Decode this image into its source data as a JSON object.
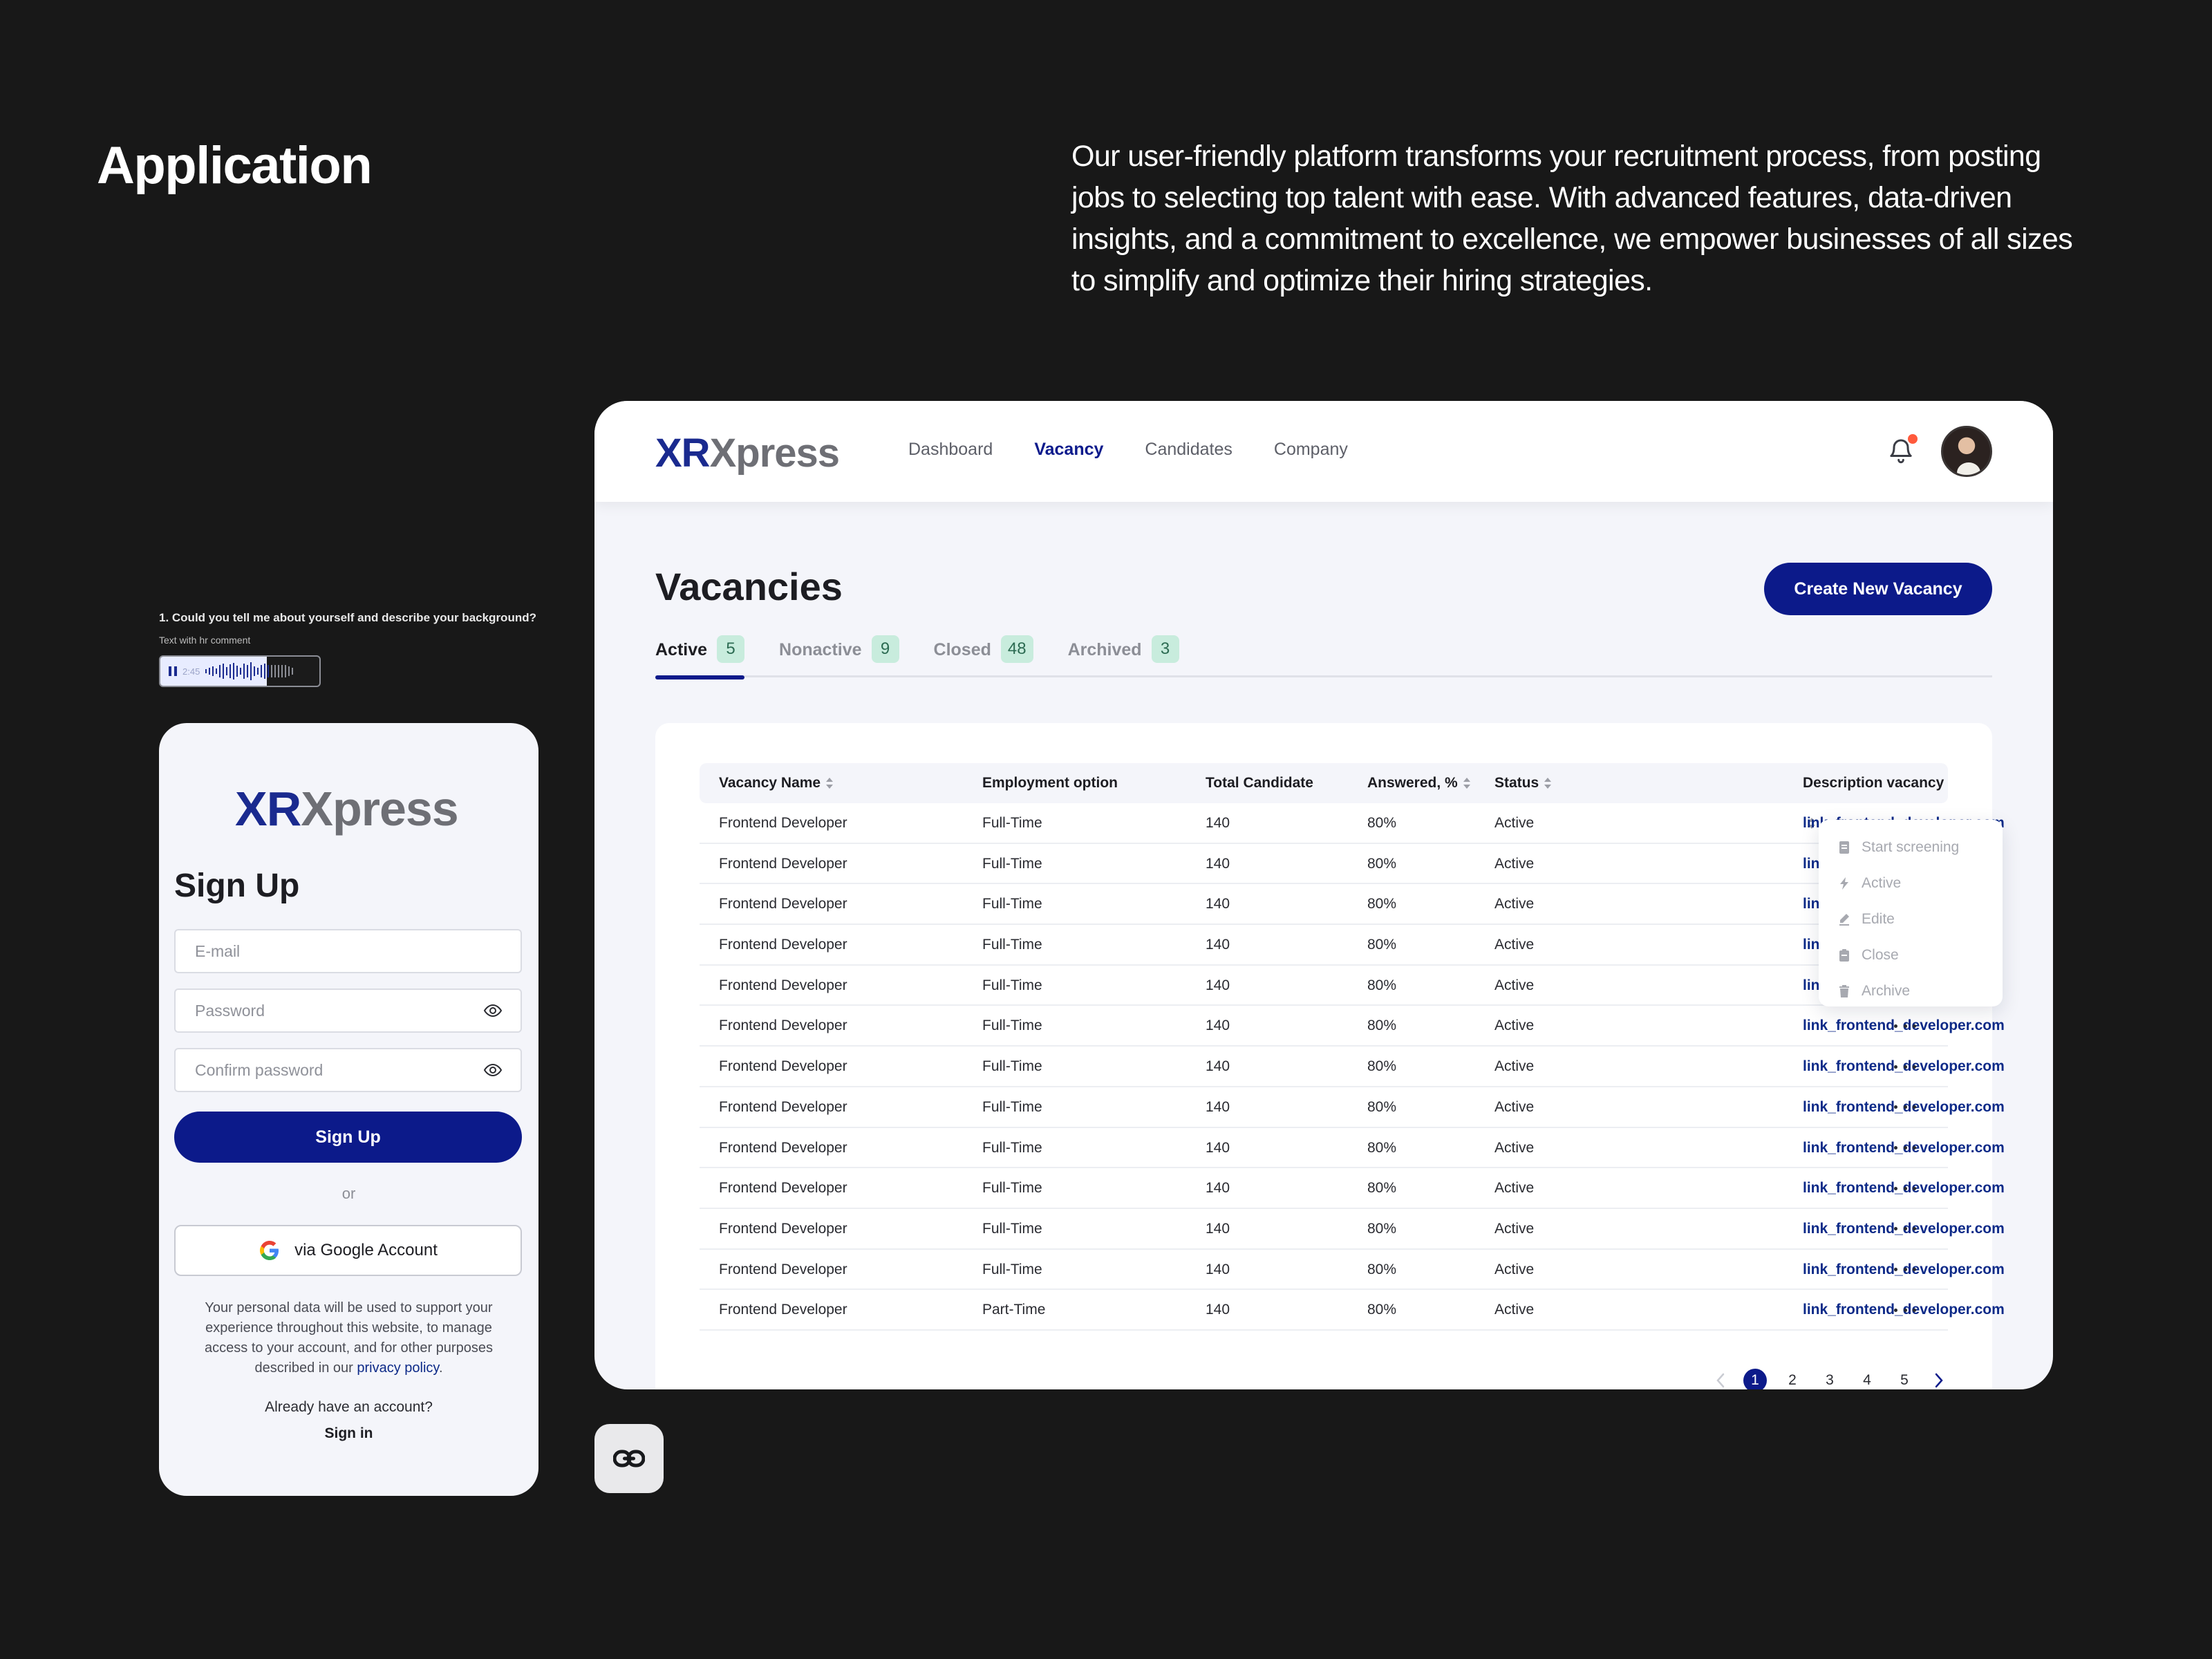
{
  "hero": {
    "title": "Application",
    "description": "Our user-friendly platform transforms your recruitment process, from posting jobs to selecting top talent with ease. With advanced features, data-driven insights, and a commitment to excellence, we empower businesses of all sizes to simplify and optimize their hiring strategies."
  },
  "brand": {
    "logo_primary": "XR",
    "logo_secondary": "Xpress",
    "primary_color": "#0c1a8a",
    "accent_color": "#1a2a8f"
  },
  "header": {
    "nav": [
      "Dashboard",
      "Vacancy",
      "Candidates",
      "Company"
    ],
    "active_nav": "Vacancy",
    "icons": [
      "bell-icon",
      "avatar"
    ]
  },
  "vacancies": {
    "title": "Vacancies",
    "create_label": "Create New Vacancy",
    "tabs": [
      {
        "label": "Active",
        "count": "5"
      },
      {
        "label": "Nonactive",
        "count": "9"
      },
      {
        "label": "Closed",
        "count": "48"
      },
      {
        "label": "Archived",
        "count": "3"
      }
    ],
    "columns": [
      "Vacancy Name",
      "Employment option",
      "Total Candidate",
      "Answered, %",
      "Status",
      "Description vacancy"
    ],
    "rows": [
      {
        "name": "Frontend Developer",
        "employment": "Full-Time",
        "total": "140",
        "answered": "80%",
        "status": "Active",
        "link": "link_frontend_developer.com"
      },
      {
        "name": "Frontend Developer",
        "employment": "Full-Time",
        "total": "140",
        "answered": "80%",
        "status": "Active",
        "link": "link_frontend_developer.com"
      },
      {
        "name": "Frontend Developer",
        "employment": "Full-Time",
        "total": "140",
        "answered": "80%",
        "status": "Active",
        "link": "link_frontend_developer.com"
      },
      {
        "name": "Frontend Developer",
        "employment": "Full-Time",
        "total": "140",
        "answered": "80%",
        "status": "Active",
        "link": "link_frontend_developer.com"
      },
      {
        "name": "Frontend Developer",
        "employment": "Full-Time",
        "total": "140",
        "answered": "80%",
        "status": "Active",
        "link": "link_frontend_developer.com"
      },
      {
        "name": "Frontend Developer",
        "employment": "Full-Time",
        "total": "140",
        "answered": "80%",
        "status": "Active",
        "link": "link_frontend_developer.com"
      },
      {
        "name": "Frontend Developer",
        "employment": "Full-Time",
        "total": "140",
        "answered": "80%",
        "status": "Active",
        "link": "link_frontend_developer.com"
      },
      {
        "name": "Frontend Developer",
        "employment": "Full-Time",
        "total": "140",
        "answered": "80%",
        "status": "Active",
        "link": "link_frontend_developer.com"
      },
      {
        "name": "Frontend Developer",
        "employment": "Full-Time",
        "total": "140",
        "answered": "80%",
        "status": "Active",
        "link": "link_frontend_developer.com"
      },
      {
        "name": "Frontend Developer",
        "employment": "Full-Time",
        "total": "140",
        "answered": "80%",
        "status": "Active",
        "link": "link_frontend_developer.com"
      },
      {
        "name": "Frontend Developer",
        "employment": "Full-Time",
        "total": "140",
        "answered": "80%",
        "status": "Active",
        "link": "link_frontend_developer.com"
      },
      {
        "name": "Frontend Developer",
        "employment": "Full-Time",
        "total": "140",
        "answered": "80%",
        "status": "Active",
        "link": "link_frontend_developer.com"
      },
      {
        "name": "Frontend Developer",
        "employment": "Part-Time",
        "total": "140",
        "answered": "80%",
        "status": "Active",
        "link": "link_frontend_developer.com"
      }
    ],
    "row_menu": [
      {
        "label": "Start screening",
        "icon": "document-icon"
      },
      {
        "label": "Active",
        "icon": "bolt-icon"
      },
      {
        "label": "Edite",
        "icon": "pencil-icon"
      },
      {
        "label": "Close",
        "icon": "clipboard-icon"
      },
      {
        "label": "Archive",
        "icon": "trash-icon"
      }
    ],
    "pagination": {
      "pages": [
        "1",
        "2",
        "3",
        "4",
        "5"
      ],
      "current": "1"
    }
  },
  "audio_comment": {
    "question": "1. Could you tell me about yourself and describe your background?",
    "subtitle": "Text with hr comment",
    "time": "2:45",
    "progress": 0.67
  },
  "signup": {
    "title": "Sign Up",
    "email_placeholder": "E-mail",
    "password_placeholder": "Password",
    "confirm_placeholder": "Confirm password",
    "submit_label": "Sign Up",
    "or_label": "or",
    "google_label": "via Google Account",
    "legal_text": "Your personal data will be used to support your experience throughout this website, to manage access to your account, and for other purposes described in our",
    "legal_link": "privacy policy",
    "have_account": "Already have an account?",
    "signin_label": "Sign in"
  },
  "link_chip": {
    "icon": "link-icon"
  }
}
